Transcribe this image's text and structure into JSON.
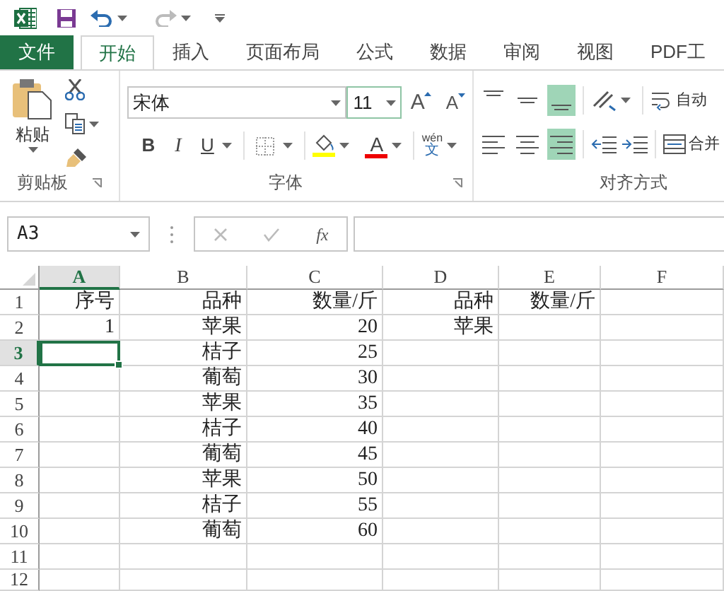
{
  "ribbon_tabs": [
    {
      "label": "文件",
      "kind": "file",
      "selected": false
    },
    {
      "label": "开始",
      "kind": "tab",
      "selected": true
    },
    {
      "label": "插入",
      "kind": "tab",
      "selected": false
    },
    {
      "label": "页面布局",
      "kind": "tab",
      "selected": false
    },
    {
      "label": "公式",
      "kind": "tab",
      "selected": false
    },
    {
      "label": "数据",
      "kind": "tab",
      "selected": false
    },
    {
      "label": "审阅",
      "kind": "tab",
      "selected": false
    },
    {
      "label": "视图",
      "kind": "tab",
      "selected": false
    },
    {
      "label": "PDF工",
      "kind": "tab",
      "selected": false
    }
  ],
  "clipboard": {
    "paste_label": "粘贴",
    "group_label": "剪贴板"
  },
  "font": {
    "name": "宋体",
    "size": "11",
    "grow": "A",
    "shrink": "A",
    "bold": "B",
    "italic": "I",
    "underline": "U",
    "font_color": "A",
    "phonetic": "wén",
    "phonetic_char": "文",
    "group_label": "字体"
  },
  "alignment": {
    "buttons": [
      {
        "kind": "top",
        "selected": false
      },
      {
        "kind": "middle",
        "selected": false
      },
      {
        "kind": "bottom",
        "selected": true
      },
      {
        "kind": "left",
        "selected": false
      },
      {
        "kind": "center",
        "selected": false
      },
      {
        "kind": "right",
        "selected": true
      }
    ],
    "wrap_text": "自动",
    "merge": "合并",
    "group_label": "对齐方式"
  },
  "formula_bar": {
    "name_box": "A3",
    "fx": "fx"
  },
  "sheet": {
    "columns": [
      {
        "label": "A",
        "selected": true
      },
      {
        "label": "B",
        "selected": false
      },
      {
        "label": "C",
        "selected": false
      },
      {
        "label": "D",
        "selected": false
      },
      {
        "label": "E",
        "selected": false
      },
      {
        "label": "F",
        "selected": false
      }
    ],
    "rows": [
      {
        "label": "1",
        "selected": false,
        "cells": {
          "a": "序号",
          "b": "品种",
          "c": "数量/斤",
          "d": "品种",
          "e": "数量/斤"
        }
      },
      {
        "label": "2",
        "selected": false,
        "cells": {
          "a": "1",
          "b": "苹果",
          "c": "20",
          "d": "苹果"
        }
      },
      {
        "label": "3",
        "selected": true,
        "cells": {
          "b": "桔子",
          "c": "25"
        }
      },
      {
        "label": "4",
        "selected": false,
        "cells": {
          "b": "葡萄",
          "c": "30"
        }
      },
      {
        "label": "5",
        "selected": false,
        "cells": {
          "b": "苹果",
          "c": "35"
        }
      },
      {
        "label": "6",
        "selected": false,
        "cells": {
          "b": "桔子",
          "c": "40"
        }
      },
      {
        "label": "7",
        "selected": false,
        "cells": {
          "b": "葡萄",
          "c": "45"
        }
      },
      {
        "label": "8",
        "selected": false,
        "cells": {
          "b": "苹果",
          "c": "50"
        }
      },
      {
        "label": "9",
        "selected": false,
        "cells": {
          "b": "桔子",
          "c": "55"
        }
      },
      {
        "label": "10",
        "selected": false,
        "cells": {
          "b": "葡萄",
          "c": "60"
        }
      },
      {
        "label": "11",
        "selected": false,
        "cells": {}
      },
      {
        "label": "12",
        "selected": false,
        "cells": {}
      }
    ]
  }
}
